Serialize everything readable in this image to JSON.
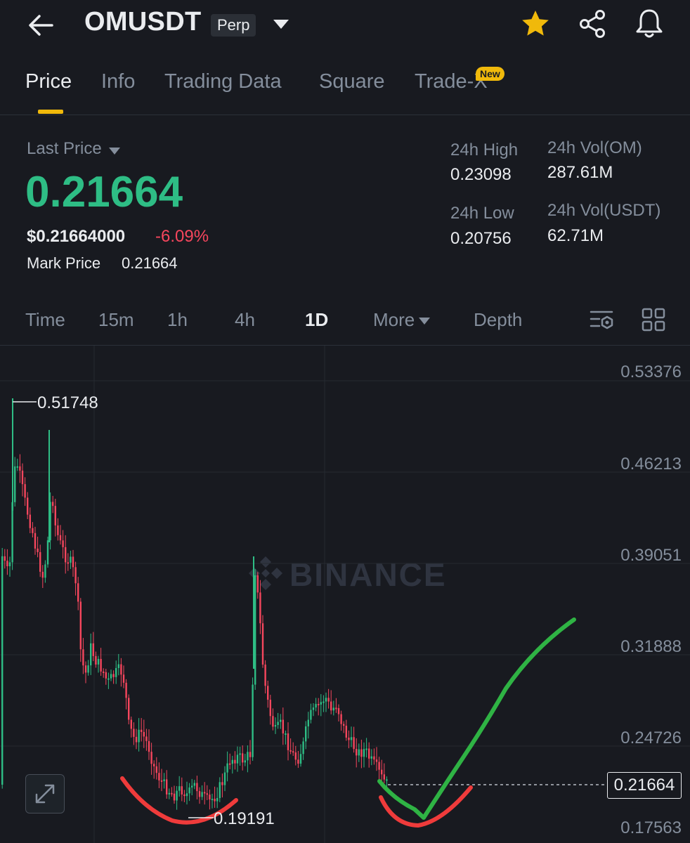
{
  "header": {
    "title": "OMUSDT",
    "contract_type": "Perp",
    "starred": true
  },
  "tabs": [
    {
      "label": "Price",
      "active": true
    },
    {
      "label": "Info",
      "active": false
    },
    {
      "label": "Trading Data",
      "active": false
    },
    {
      "label": "Square",
      "active": false
    },
    {
      "label": "Trade-X",
      "active": false,
      "badge": "New"
    }
  ],
  "ticker": {
    "last_price_label": "Last Price",
    "last_price": "0.21664",
    "usd_price": "$0.21664000",
    "change_pct": "-6.09%",
    "mark_price_label": "Mark Price",
    "mark_price": "0.21664",
    "high_label": "24h High",
    "high": "0.23098",
    "low_label": "24h Low",
    "low": "0.20756",
    "vol_om_label": "24h Vol(OM)",
    "vol_om": "287.61M",
    "vol_usdt_label": "24h Vol(USDT)",
    "vol_usdt": "62.71M"
  },
  "intervals": [
    {
      "label": "Time",
      "active": false
    },
    {
      "label": "15m",
      "active": false
    },
    {
      "label": "1h",
      "active": false
    },
    {
      "label": "4h",
      "active": false
    },
    {
      "label": "1D",
      "active": true
    },
    {
      "label": "More",
      "active": false
    },
    {
      "label": "Depth",
      "active": false
    }
  ],
  "chart": {
    "watermark": "BINANCE",
    "y_axis_labels": [
      "0.53376",
      "0.46213",
      "0.39051",
      "0.31888",
      "0.24726",
      "0.17563"
    ],
    "current_price": "0.21664",
    "high_marker": "0.51748",
    "low_marker": "0.19191"
  },
  "colors": {
    "background": "#181a20",
    "up": "#2ebd85",
    "down": "#f6465d",
    "accent": "#f0b90b",
    "muted": "#848e9c",
    "annotation_red": "#ef3b3b",
    "annotation_green": "#2fb344"
  }
}
